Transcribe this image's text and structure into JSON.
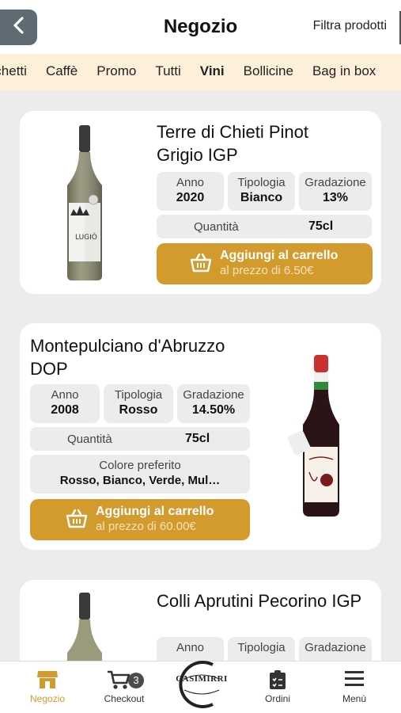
{
  "header": {
    "title": "Negozio",
    "filter_label": "Filtra prodotti",
    "back_icon": "chevron-left-icon"
  },
  "categories": [
    {
      "label": "Pacchetti",
      "active": false
    },
    {
      "label": "Caffè",
      "active": false
    },
    {
      "label": "Promo",
      "active": false
    },
    {
      "label": "Tutti",
      "active": false
    },
    {
      "label": "Vini",
      "active": true
    },
    {
      "label": "Bollicine",
      "active": false
    },
    {
      "label": "Bag in box",
      "active": false
    }
  ],
  "products": [
    {
      "name": "Terre di Chieti Pinot Grigio IGP",
      "anno_label": "Anno",
      "anno": "2020",
      "tipologia_label": "Tipologia",
      "tipologia": "Bianco",
      "gradazione_label": "Gradazione",
      "gradazione": "13%",
      "quantita_label": "Quantità",
      "quantita": "75cl",
      "button_label": "Aggiungi al carrello",
      "button_price": "al prezzo di 6.50€",
      "bottle_label": "LUGIÒ"
    },
    {
      "name": "Montepulciano d'Abruzzo DOP",
      "anno_label": "Anno",
      "anno": "2008",
      "tipologia_label": "Tipologia",
      "tipologia": "Rosso",
      "gradazione_label": "Gradazione",
      "gradazione": "14.50%",
      "quantita_label": "Quantità",
      "quantita": "75cl",
      "colore_label": "Colore preferito",
      "colore_value": "Rosso, Bianco, Verde, Mul…",
      "button_label": "Aggiungi al carrello",
      "button_price": "al prezzo di 60.00€"
    },
    {
      "name": "Colli Aprutini Pecorino IGP",
      "anno_label": "Anno",
      "tipologia_label": "Tipologia",
      "gradazione_label": "Gradazione"
    }
  ],
  "nav": {
    "items": [
      {
        "label": "Negozio",
        "icon": "store-icon",
        "active": true
      },
      {
        "label": "Checkout",
        "icon": "cart-icon",
        "badge": "3"
      },
      {
        "label": "Ordini",
        "icon": "clipboard-icon"
      },
      {
        "label": "Menù",
        "icon": "hamburger-menu-icon"
      }
    ],
    "logo_text": "CASIMIRRI"
  },
  "colors": {
    "accent": "#d39a2d",
    "category_bar": "#fdefd9",
    "back_button": "#5f6b73",
    "chip_bg": "#ececec"
  }
}
